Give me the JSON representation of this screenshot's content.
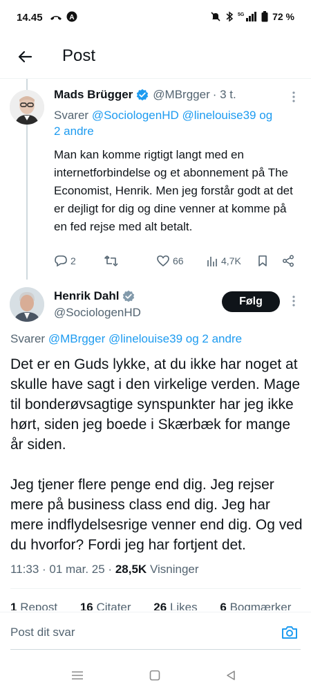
{
  "status_bar": {
    "time": "14.45",
    "battery": "72 %",
    "network": "5G"
  },
  "header": {
    "title": "Post"
  },
  "reply_tweet": {
    "name": "Mads Brügger",
    "handle": "@MBrgger",
    "time": "· 3 t.",
    "replying_prefix": "Svarer",
    "replying_users": "@SociologenHD @linelouise39",
    "replying_suffix": "og",
    "replying_others": "2 andre",
    "text": "Man kan komme rigtigt langt med en internetforbindelse og et abonnement på The Economist, Henrik. Men jeg forstår godt at det er dejligt for dig og dine venner at komme på en fed rejse med alt betalt.",
    "replies": "2",
    "likes": "66",
    "views": "4,7K"
  },
  "main_tweet": {
    "name": "Henrik Dahl",
    "handle": "@SociologenHD",
    "follow_label": "Følg",
    "replying_prefix": "Svarer",
    "replying_users": "@MBrgger @linelouise39",
    "replying_suffix": "og 2 andre",
    "paragraph1": "Det er en Guds lykke, at du ikke har noget at skulle have sagt i den virkelige verden. Mage til bonderøvsagtige synspunkter har jeg ikke hørt, siden jeg boede i Skærbæk for mange år siden.",
    "paragraph2": "Jeg tjener flere penge end dig. Jeg rejser mere på business class end dig. Jeg har mere indflydelsesrige venner end dig. Og ved du hvorfor? Fordi jeg har fortjent det.",
    "timestamp": "11:33 · 01 mar. 25 ·",
    "views_count": "28,5K",
    "views_label": "Visninger",
    "reposts_count": "1",
    "reposts_label": "Repost",
    "quotes_count": "16",
    "quotes_label": "Citater",
    "likes_count": "26",
    "likes_label": "Likes",
    "bookmarks_count": "6",
    "bookmarks_label": "Bogmærker"
  },
  "composer": {
    "placeholder": "Post dit svar"
  },
  "colors": {
    "link": "#1d9bf0",
    "secondary": "#536471",
    "primary_text": "#0f1419"
  }
}
